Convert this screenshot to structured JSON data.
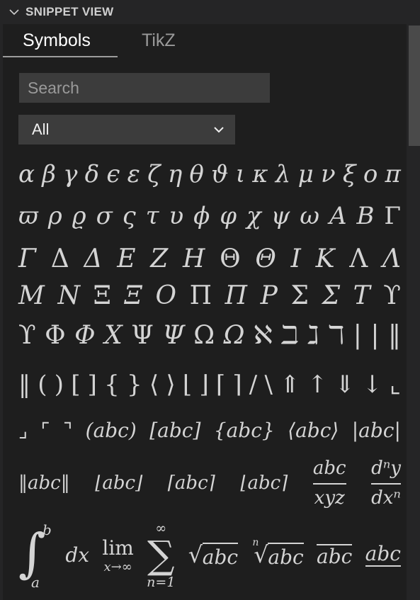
{
  "header": {
    "title": "SNIPPET VIEW",
    "icon": "chevron-down-icon"
  },
  "tabs": [
    {
      "label": "Symbols",
      "active": true
    },
    {
      "label": "TikZ",
      "active": false
    }
  ],
  "search": {
    "placeholder": "Search",
    "value": ""
  },
  "filter": {
    "selected": "All"
  },
  "symbols": {
    "row1": [
      "α",
      "β",
      "γ",
      "δ",
      "ϵ",
      "ε",
      "ζ",
      "η",
      "θ",
      "ϑ",
      "ι",
      "κ",
      "λ",
      "μ",
      "ν",
      "ξ",
      "ο",
      "π"
    ],
    "row2": [
      "ϖ",
      "ρ",
      "ϱ",
      "σ",
      "ς",
      "τ",
      "υ",
      "ϕ",
      "φ",
      "χ",
      "ψ",
      "ω",
      "A",
      "B",
      "Γ"
    ],
    "row3": [
      "Γ",
      "Δ",
      "Δ",
      "E",
      "Z",
      "H",
      "Θ",
      "Θ",
      "I",
      "K",
      "Λ",
      "Λ"
    ],
    "row4": [
      "M",
      "N",
      "Ξ",
      "Ξ",
      "O",
      "Π",
      "Π",
      "P",
      "Σ",
      "Σ",
      "T",
      "ϒ"
    ],
    "row5": [
      "ϒ",
      "Φ",
      "Φ",
      "X",
      "Ψ",
      "Ψ",
      "Ω",
      "Ω",
      "ℵ",
      "ℶ",
      "ℷ",
      "ℸ",
      "|",
      "|",
      "‖"
    ],
    "row6": [
      "‖",
      "(",
      ")",
      "[",
      "]",
      "{",
      "}",
      "⟨",
      "⟩",
      "⌊",
      "⌋",
      "⌈",
      "⌉",
      "/",
      "\\",
      "⇑",
      "↑",
      "⇓",
      "↓",
      "⌞"
    ],
    "row7": [
      "⌟",
      "⌜",
      "⌝",
      "(abc)",
      "[abc]",
      "{abc}",
      "⟨abc⟩",
      "|abc|"
    ],
    "row8": {
      "simple": [
        "‖abc‖",
        "⌊abc⌋",
        "⌈abc⌉",
        "⌊abc⌉"
      ],
      "frac1_num": "abc",
      "frac1_den": "xyz",
      "frac2_num": "dⁿy",
      "frac2_den": "dxⁿ"
    },
    "row9": {
      "integral_sign": "∫",
      "integral_upper": "b",
      "integral_lower": "a",
      "dx": "dx",
      "lim": "lim",
      "lim_sub": "x→∞",
      "sum_sign": "∑",
      "sum_upper": "∞",
      "sum_lower": "n=1",
      "sqrt_body": "abc",
      "nroot_index": "n",
      "nroot_body": "abc",
      "overline": "abc",
      "underline": "abc"
    }
  }
}
